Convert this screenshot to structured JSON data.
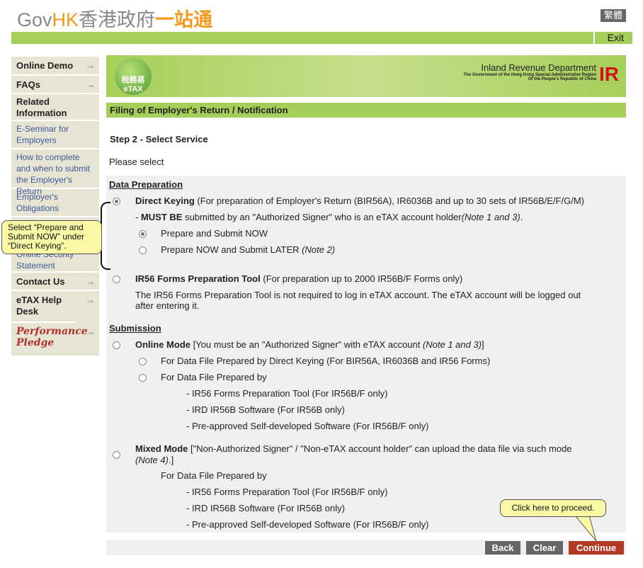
{
  "header": {
    "logo_gov": "Gov",
    "logo_hk": "HK",
    "logo_zh1": "香港政府",
    "logo_zh2": "一站通",
    "lang_button": "繁體",
    "exit": "Exit"
  },
  "sidebar": {
    "items": [
      {
        "label": "Online Demo",
        "arrow": "→"
      },
      {
        "label": "FAQs",
        "arrow": "→"
      },
      {
        "label": "Related Information"
      },
      {
        "label": "E-Seminar for Employers"
      },
      {
        "label": "How to complete and when to submit the Employer's Return"
      },
      {
        "label": "Employer's Obligations"
      },
      {
        "label": "Online Security Statement"
      },
      {
        "label": "Contact Us",
        "arrow": "→"
      },
      {
        "label": "eTAX Help Desk",
        "arrow": "→"
      },
      {
        "label": "Performance Pledge",
        "arrow": "→"
      }
    ]
  },
  "banner": {
    "etax_logo": "稅務易 eTAX",
    "dept": "Inland Revenue Department",
    "line1": "The Government of the Hong Kong Special Administrative Region",
    "line2": "Of the People's Republic of China",
    "ir_logo": "IR"
  },
  "page": {
    "title": "Filing of Employer's Return / Notification",
    "step": "Step 2 - Select Service",
    "please": "Please select"
  },
  "form": {
    "data_prep": "Data Preparation",
    "direct_keying": {
      "bold": "Direct Keying",
      "text": " (For preparation of Employer's Return (BIR56A), IR6036B and up to 30 sets of IR56B/E/F/G/M)",
      "selected": true
    },
    "must_be": {
      "pre": "- ",
      "bold": "MUST BE",
      "text": " submitted by an \"Authorized Signer\" who is an eTAX account holder",
      "note": "(Note 1 and 3)",
      "post": "."
    },
    "prep_now": {
      "label": "Prepare and Submit NOW",
      "selected": true
    },
    "prep_later": {
      "label": "Prepare NOW and Submit LATER ",
      "note": "(Note 2)",
      "selected": false
    },
    "ir56_tool": {
      "bold": "IR56 Forms Preparation Tool",
      "text": " (For preparation up to 2000 IR56B/F Forms only)",
      "selected": false
    },
    "ir56_desc1": "The IR56 Forms Preparation Tool is not required to log in eTAX account. The eTAX account will be logged out",
    "ir56_desc2": "after entering it.",
    "submission": "Submission",
    "online_mode": {
      "bold": "Online Mode",
      "text": " [You must be an \"Authorized Signer\" with eTAX account ",
      "note": "(Note 1 and 3)",
      "post": "]"
    },
    "online_sub1": "For Data File Prepared by Direct Keying (For BIR56A, IR6036B and IR56 Forms)",
    "online_sub2": "For Data File Prepared by",
    "online_items": [
      "- IR56 Forms Preparation Tool (For IR56B/F only)",
      "- IRD IR56B Software (For IR56B only)",
      "- Pre-approved Self-developed Software (For IR56B/F only)"
    ],
    "mixed_mode": {
      "bold": "Mixed Mode",
      "text": " [\"Non-Authorized Signer\" / \"Non-eTAX account holder\" can upload the data file via such mode",
      "note": "(Note 4)",
      "post": ".]"
    },
    "mixed_sub": "For Data File Prepared by",
    "mixed_items": [
      "- IR56 Forms Preparation Tool (For IR56B/F only)",
      "- IRD IR56B Software (For IR56B only)",
      "- Pre-approved Self-developed Software (For IR56B/F only)"
    ]
  },
  "buttons": {
    "back": "Back",
    "clear": "Clear",
    "continue": "Continue"
  },
  "callouts": {
    "select": "Select “Prepare and Submit NOW” under “Direct Keying”.",
    "proceed": "Click here to proceed."
  },
  "colors": {
    "green": "#a6cf5a",
    "continue": "#b23a22",
    "gray_button": "#666666",
    "callout": "#fbf8a6"
  }
}
